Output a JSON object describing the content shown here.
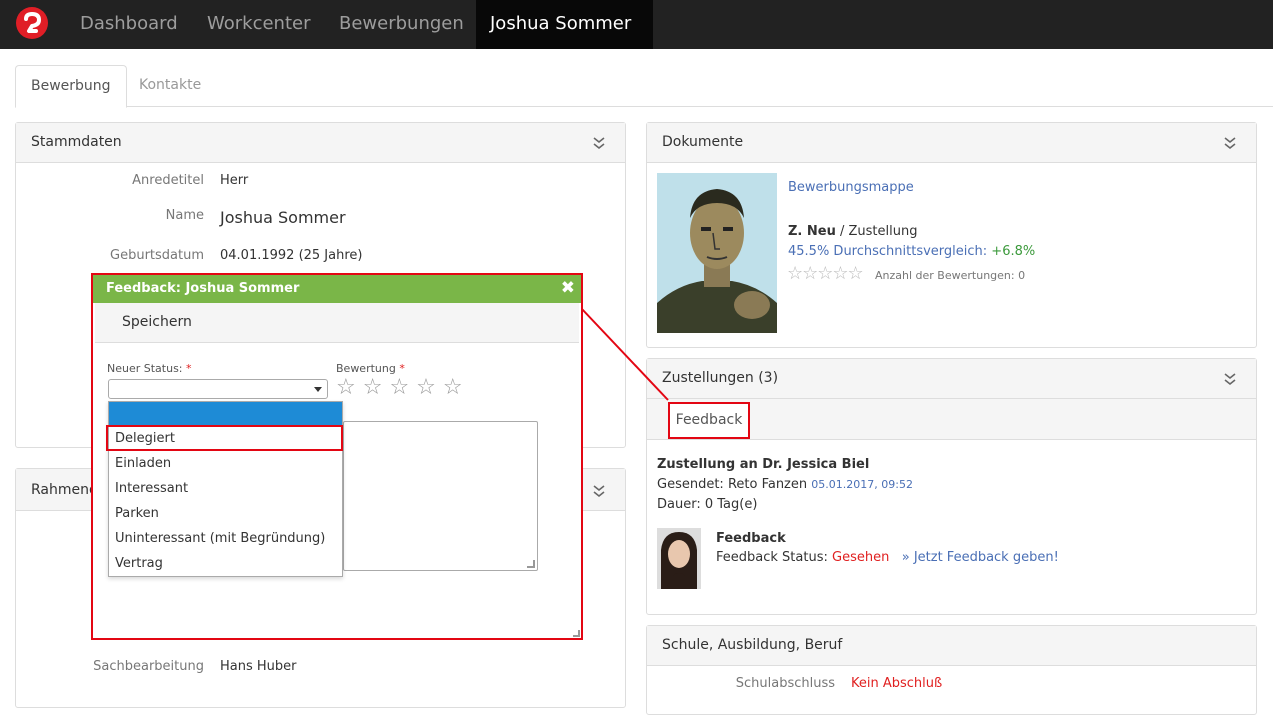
{
  "nav": {
    "items": [
      "Dashboard",
      "Workcenter",
      "Bewerbungen"
    ],
    "user": "Joshua Sommer"
  },
  "tabs": {
    "active": "Bewerbung",
    "inactive": "Kontakte"
  },
  "stammdaten": {
    "title": "Stammdaten",
    "rows": [
      {
        "label": "Anredetitel",
        "value": "Herr"
      },
      {
        "label": "Name",
        "value": "Joshua Sommer"
      },
      {
        "label": "Geburtsdatum",
        "value": "04.01.1992 (25 Jahre)"
      }
    ],
    "sachbearbeitung_label": "Sachbearbeitung",
    "sachbearbeitung_value": "Hans Huber"
  },
  "rahmen": {
    "title": "Rahmend"
  },
  "dokumente": {
    "title": "Dokumente",
    "link": "Bewerbungsmappe",
    "status_bold": "Z. Neu",
    "status_rest": " / Zustellung",
    "vergleich": "45.5% Durchschnittsvergleich:",
    "vergleich_delta": "+6.8%",
    "bewertungen": "Anzahl der Bewertungen: 0",
    "stars": "☆☆☆☆☆"
  },
  "zustellungen": {
    "title": "Zustellungen (3)",
    "tab": "Feedback",
    "heading": "Zustellung an Dr. Jessica Biel",
    "gesendet_label": "Gesendet: Reto Fanzen",
    "gesendet_date": "05.01.2017, 09:52",
    "dauer": "Dauer: 0 Tag(e)",
    "fb_title": "Feedback",
    "fb_status_label": "Feedback Status:",
    "fb_status": "Gesehen",
    "fb_link": "» Jetzt Feedback geben!"
  },
  "schule": {
    "title": "Schule, Ausbildung, Beruf",
    "label": "Schulabschluss",
    "value": "Kein Abschluß"
  },
  "dialog": {
    "title": "Feedback: Joshua Sommer",
    "save": "Speichern",
    "status_label": "Neuer Status:",
    "rating_label": "Bewertung",
    "required": "*",
    "rating_stars": "☆☆☆☆☆",
    "close": "✖",
    "options": [
      "",
      "Delegiert",
      "Einladen",
      "Interessant",
      "Parken",
      "Uninteressant (mit Begründung)",
      "Vertrag"
    ]
  },
  "colors": {
    "accent_green": "#7ab648",
    "highlight_red": "#e30613",
    "selected_blue": "#1e8bd6"
  }
}
